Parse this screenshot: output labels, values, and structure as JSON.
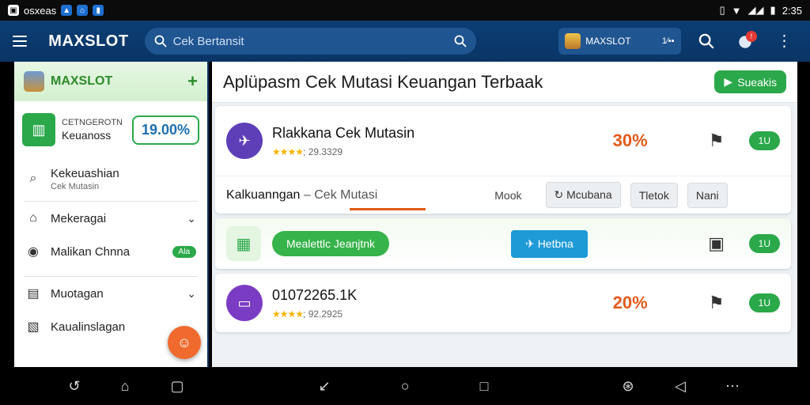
{
  "statusbar": {
    "carrier": "osxeas",
    "time": "2:35"
  },
  "header": {
    "brand": "MAXSLOT",
    "search_placeholder": "Cek Bertansit",
    "account": {
      "name": "MAXSLOT",
      "value": "1∕▪▪"
    },
    "notif_count": "!"
  },
  "sidebar": {
    "brand": "MAXSLOT",
    "card": {
      "line1": "CETNGEROTN",
      "line2": "Keuanoss",
      "percent": "19.00%"
    },
    "items": [
      {
        "label": "Kekeuashian",
        "sub": "Cek Mutasin"
      },
      {
        "label": "Mekeragai"
      },
      {
        "label": "Malikan Chnna",
        "badge": "Ala"
      },
      {
        "label": "Muotagan"
      },
      {
        "label": "Kaualinslagan"
      }
    ]
  },
  "main": {
    "title": "Aplüpasm Cek Mutasi Keuangan Terbaak",
    "action_label": "Sueakis",
    "rows": [
      {
        "title": "Rlakkana Cek Mutasin",
        "rating": "; 29.3329",
        "percent": "30%",
        "pill": "1U"
      },
      {
        "title": "01072265.1K",
        "rating": "; 92.2925",
        "percent": "20%",
        "pill": "1U"
      }
    ],
    "tabs": {
      "main_a": "Kalkuanngan",
      "main_sep": "–",
      "main_b": "Cek Mutasi",
      "secondary": "Mook",
      "btn1": "Mcubana",
      "btn2": "Tletok",
      "btn3": "Nani"
    },
    "promo": {
      "pill": "Mealettlc Jeanjtnk",
      "button": "Hetbna",
      "badge": "1U"
    }
  },
  "colors": {
    "header_bg": "#0b3d73",
    "accent_green": "#2aa84a",
    "accent_orange": "#e35b1a",
    "accent_blue": "#1e9ad6"
  }
}
